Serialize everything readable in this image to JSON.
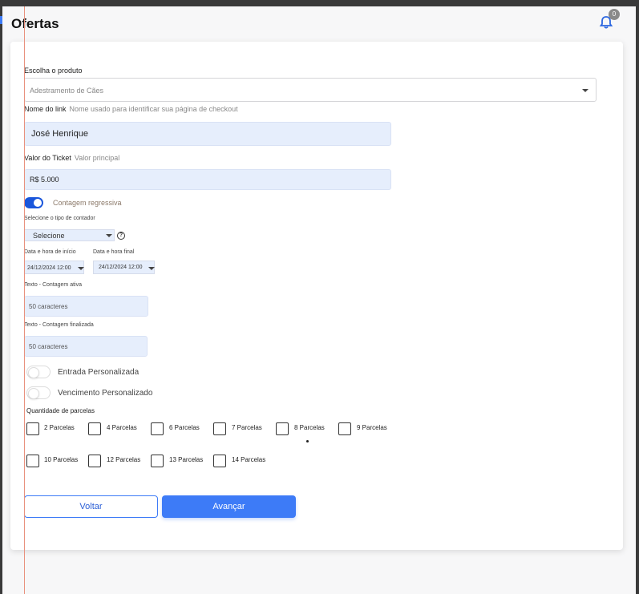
{
  "header": {
    "title": "Ofertas",
    "notification_count": "0"
  },
  "product": {
    "label": "Escolha o produto",
    "value": "Adestramento de Cães"
  },
  "link_name": {
    "label": "Nome do link",
    "hint": "Nome usado para identificar sua página de checkout",
    "value": "José Henrique"
  },
  "ticket": {
    "label": "Valor do Ticket",
    "hint": "Valor principal",
    "value": "R$ 5.000"
  },
  "countdown": {
    "toggle_label": "Contagem regressiva",
    "enabled": true,
    "type_label": "Selecione o tipo de contador",
    "type_value": "Selecione",
    "start_label": "Data e hora de início",
    "start_value": "24/12/2024 12:00",
    "end_label": "Data e hora final",
    "end_value": "24/12/2024 12:00",
    "active_text_label": "Texto - Contagem ativa",
    "active_text_placeholder": "50 caracteres",
    "finished_text_label": "Texto - Contagem finalizada",
    "finished_text_placeholder": "50 caracteres"
  },
  "custom_entry": {
    "label": "Entrada Personalizada",
    "enabled": false
  },
  "custom_due": {
    "label": "Vencimento Personalizado",
    "enabled": false
  },
  "installments": {
    "label": "Quantidade de parcelas",
    "row1": [
      "2 Parcelas",
      "4 Parcelas",
      "6 Parcelas",
      "7 Parcelas",
      "8 Parcelas",
      "9 Parcelas"
    ],
    "row2": [
      "10 Parcelas",
      "12 Parcelas",
      "13 Parcelas",
      "14 Parcelas"
    ]
  },
  "actions": {
    "back_label": "Voltar",
    "next_label": "Avançar"
  },
  "colors": {
    "primary": "#3d7bf7",
    "toggle_on": "#1a56db",
    "field_bg": "#e6eefc"
  }
}
